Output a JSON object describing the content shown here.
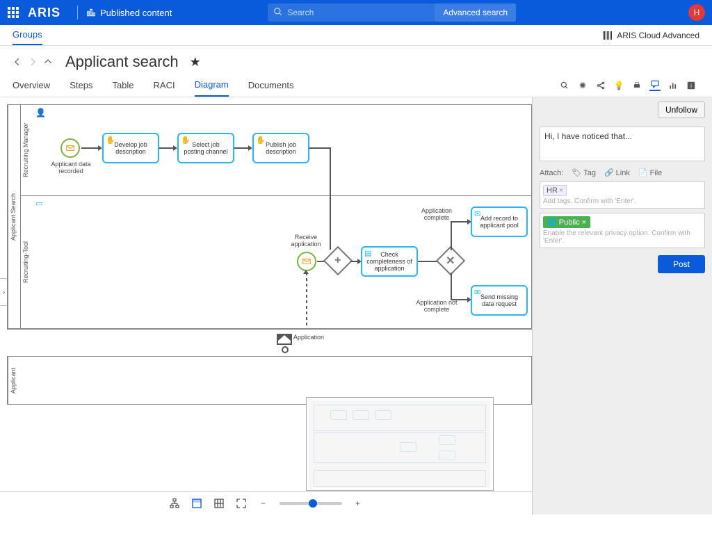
{
  "header": {
    "brand": "ARIS",
    "published": "Published content",
    "search_placeholder": "Search",
    "advanced": "Advanced search",
    "avatar": "H"
  },
  "subheader": {
    "groups": "Groups",
    "edition": "ARIS Cloud Advanced"
  },
  "page": {
    "title": "Applicant search",
    "star": "★"
  },
  "tabs": {
    "overview": "Overview",
    "steps": "Steps",
    "table": "Table",
    "raci": "RACI",
    "diagram": "Diagram",
    "documents": "Documents"
  },
  "side": {
    "unfollow": "Unfollow",
    "comment": "Hi, I have noticed that...",
    "attach": "Attach:",
    "tag": "Tag",
    "link": "Link",
    "file": "File",
    "tag_chip": "HR",
    "tag_ph": "Add tags. Confirm with 'Enter'.",
    "privacy_chip": "Public",
    "privacy_ph": "Enable the relevant privacy option. Confirm with 'Enter'.",
    "post": "Post"
  },
  "diagram": {
    "pool1": "Applicant Search",
    "lane1": "Recruiting Manager",
    "lane2": "Recruiting-Tool",
    "pool2": "Applicant",
    "evt1": "Applicant data recorded",
    "task1": "Develop job description",
    "task2": "Select job posting channel",
    "task3": "Publish job description",
    "evt2": "Receive application",
    "task4": "Check completeness of application",
    "gw_top": "Application complete",
    "gw_bot": "Application not complete",
    "task5": "Add record to applicant pool",
    "task6": "Send missing data request",
    "msg": "Application"
  }
}
